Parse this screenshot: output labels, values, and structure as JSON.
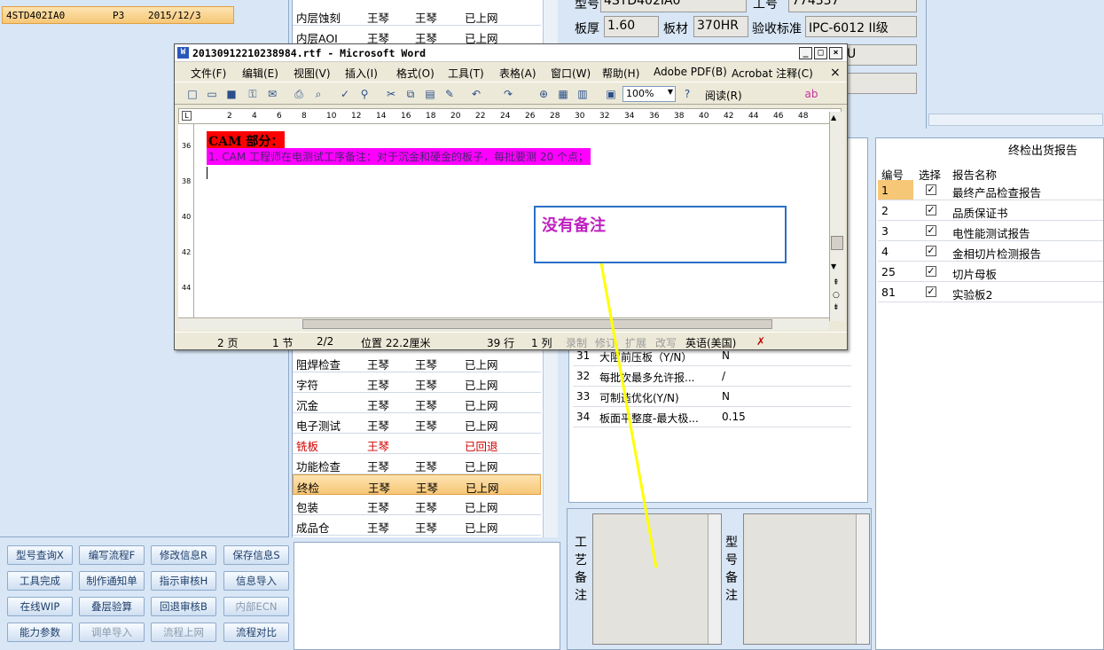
{
  "left": {
    "order": {
      "code": "4STD402IA0",
      "rev": "P3",
      "date": "2015/12/3"
    }
  },
  "buttons": [
    {
      "label": "型号查询X",
      "enabled": true
    },
    {
      "label": "编写流程F",
      "enabled": true
    },
    {
      "label": "修改信息R",
      "enabled": true
    },
    {
      "label": "保存信息S",
      "enabled": true
    },
    {
      "label": "工具完成",
      "enabled": true
    },
    {
      "label": "制作通知单",
      "enabled": true
    },
    {
      "label": "指示审核H",
      "enabled": true
    },
    {
      "label": "信息导入",
      "enabled": true
    },
    {
      "label": "在线WIP",
      "enabled": true
    },
    {
      "label": "叠层验算",
      "enabled": true
    },
    {
      "label": "回退审核B",
      "enabled": true
    },
    {
      "label": "内部ECN",
      "enabled": false
    },
    {
      "label": "能力参数",
      "enabled": true
    },
    {
      "label": "调单导入",
      "enabled": false
    },
    {
      "label": "流程上网",
      "enabled": false
    },
    {
      "label": "流程对比",
      "enabled": true
    }
  ],
  "process": {
    "rows": [
      {
        "step": "内层蚀刻",
        "a": "王琴",
        "b": "王琴",
        "status": "已上网",
        "state": ""
      },
      {
        "step": "内层AOI",
        "a": "王琴",
        "b": "王琴",
        "status": "已上网",
        "state": ""
      },
      {
        "step": "阻焊检查",
        "a": "王琴",
        "b": "王琴",
        "status": "已上网",
        "state": ""
      },
      {
        "step": "字符",
        "a": "王琴",
        "b": "王琴",
        "status": "已上网",
        "state": ""
      },
      {
        "step": "沉金",
        "a": "王琴",
        "b": "王琴",
        "status": "已上网",
        "state": ""
      },
      {
        "step": "电子测试",
        "a": "王琴",
        "b": "王琴",
        "status": "已上网",
        "state": ""
      },
      {
        "step": "铣板",
        "a": "王琴",
        "b": "",
        "status": "已回退",
        "state": "red"
      },
      {
        "step": "功能检查",
        "a": "王琴",
        "b": "王琴",
        "status": "已上网",
        "state": ""
      },
      {
        "step": "终检",
        "a": "王琴",
        "b": "王琴",
        "status": "已上网",
        "state": "sel"
      },
      {
        "step": "包装",
        "a": "王琴",
        "b": "王琴",
        "status": "已上网",
        "state": ""
      },
      {
        "step": "成品仓",
        "a": "王琴",
        "b": "王琴",
        "status": "已上网",
        "state": ""
      }
    ]
  },
  "params": {
    "model_label": "型号",
    "model_value": "4STD402IA0",
    "job_label": "工号",
    "job_value": "774337",
    "thickness_label": "板厚",
    "thickness_value": "1.60",
    "material_label": "板材",
    "material_value": "370HR",
    "standard_label": "验收标准",
    "standard_value": "IPC-6012 II级",
    "extra_value": "U"
  },
  "spec": {
    "rows": [
      {
        "no": "31",
        "name": "大阻前压板（Y/N）",
        "value": "N"
      },
      {
        "no": "32",
        "name": "每批次最多允许报...",
        "value": "/"
      },
      {
        "no": "33",
        "name": "可制造优化(Y/N)",
        "value": "N"
      },
      {
        "no": "34",
        "name": "板面平整度-最大极...",
        "value": "0.15"
      }
    ]
  },
  "remarks": {
    "process_label": "工艺备注",
    "model_label": "型号备注"
  },
  "report": {
    "title": "终检出货报告",
    "col_no": "编号",
    "col_sel": "选择",
    "col_name": "报告名称",
    "rows": [
      {
        "no": "1",
        "name": "最终产品检查报告",
        "checked": true
      },
      {
        "no": "2",
        "name": "品质保证书",
        "checked": true
      },
      {
        "no": "3",
        "name": "电性能测试报告",
        "checked": true
      },
      {
        "no": "4",
        "name": "金相切片检测报告",
        "checked": true
      },
      {
        "no": "25",
        "name": "切片母板",
        "checked": true
      },
      {
        "no": "81",
        "name": "实验板2",
        "checked": true
      }
    ]
  },
  "word": {
    "title": "20130912210238984.rtf - Microsoft Word",
    "menu": [
      "文件(F)",
      "编辑(E)",
      "视图(V)",
      "插入(I)",
      "格式(O)",
      "工具(T)",
      "表格(A)",
      "窗口(W)",
      "帮助(H)",
      "Adobe PDF(B)",
      "Acrobat 注释(C)"
    ],
    "zoom": "100%",
    "read_label": "阅读(R)",
    "ruler": [
      "2",
      "4",
      "6",
      "8",
      "10",
      "12",
      "14",
      "16",
      "18",
      "20",
      "22",
      "24",
      "26",
      "28",
      "30",
      "32",
      "34",
      "36",
      "38",
      "40",
      "42",
      "44",
      "46",
      "48"
    ],
    "vruler": [
      "36",
      "38",
      "40",
      "42",
      "44",
      "46"
    ],
    "heading": "CAM 部分：",
    "line1": "1.  CAM 工程师在电测试工序备注：对于沉金和硬金的板子，每批要测 20 个点；",
    "status": {
      "page": "2 页",
      "section": "1 节",
      "pages": "2/2",
      "pos": "位置 22.2厘米",
      "line": "39 行",
      "col": "1 列",
      "rec": "录制",
      "rev": "修订",
      "ext": "扩展",
      "ovr": "改写",
      "lang": "英语(美国)"
    }
  },
  "callout": {
    "text": "没有备注"
  },
  "colors": {
    "accent": "#2a6fc8",
    "highlight_magenta": "#ff00ff",
    "highlight_red": "#ff0000",
    "arrow": "#ffff00",
    "selected": "#f6c777"
  }
}
